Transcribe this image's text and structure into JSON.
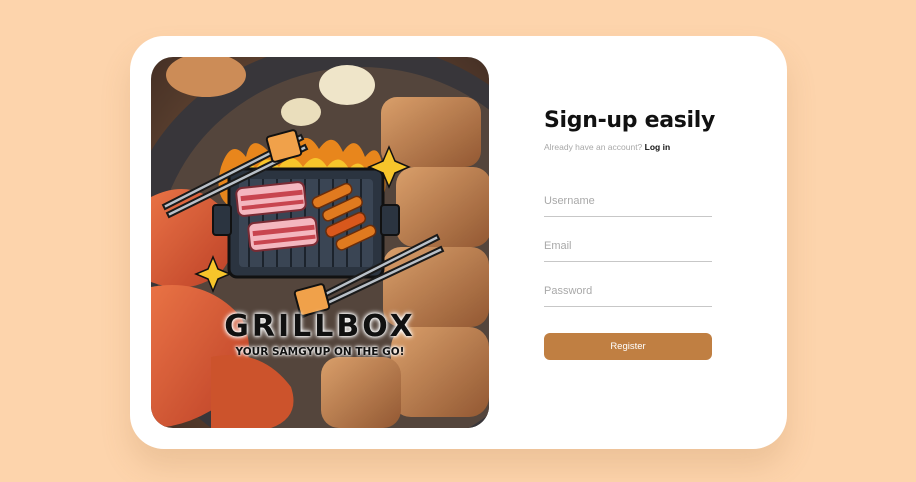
{
  "hero": {
    "logo_title": "GRILLBOX",
    "logo_tagline": "YOUR SAMGYUP ON THE GO!"
  },
  "form": {
    "heading": "Sign-up easily",
    "subtext": "Already have an account?",
    "login_link": "Log in",
    "username_placeholder": "Username",
    "email_placeholder": "Email",
    "password_placeholder": "Password",
    "register_label": "Register"
  },
  "colors": {
    "page_background": "#FDD4AC",
    "card": "#FFFFFF",
    "accent": "#C07F42"
  }
}
